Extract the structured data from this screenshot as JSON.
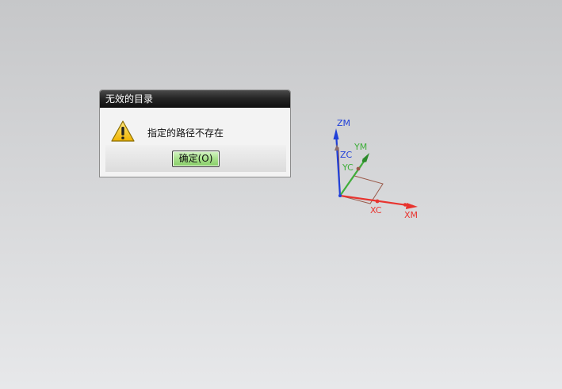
{
  "dialog": {
    "title": "无效的目录",
    "message": "指定的路径不存在",
    "icon": "warning-icon",
    "ok_label": "确定(O)"
  },
  "triad": {
    "labels": {
      "zm": "ZM",
      "zc": "ZC",
      "ym": "YM",
      "yc": "YC",
      "xc": "XC",
      "xm": "XM"
    },
    "colors": {
      "x": "#e8342f",
      "y": "#3fae3a",
      "z": "#2040d8"
    }
  }
}
